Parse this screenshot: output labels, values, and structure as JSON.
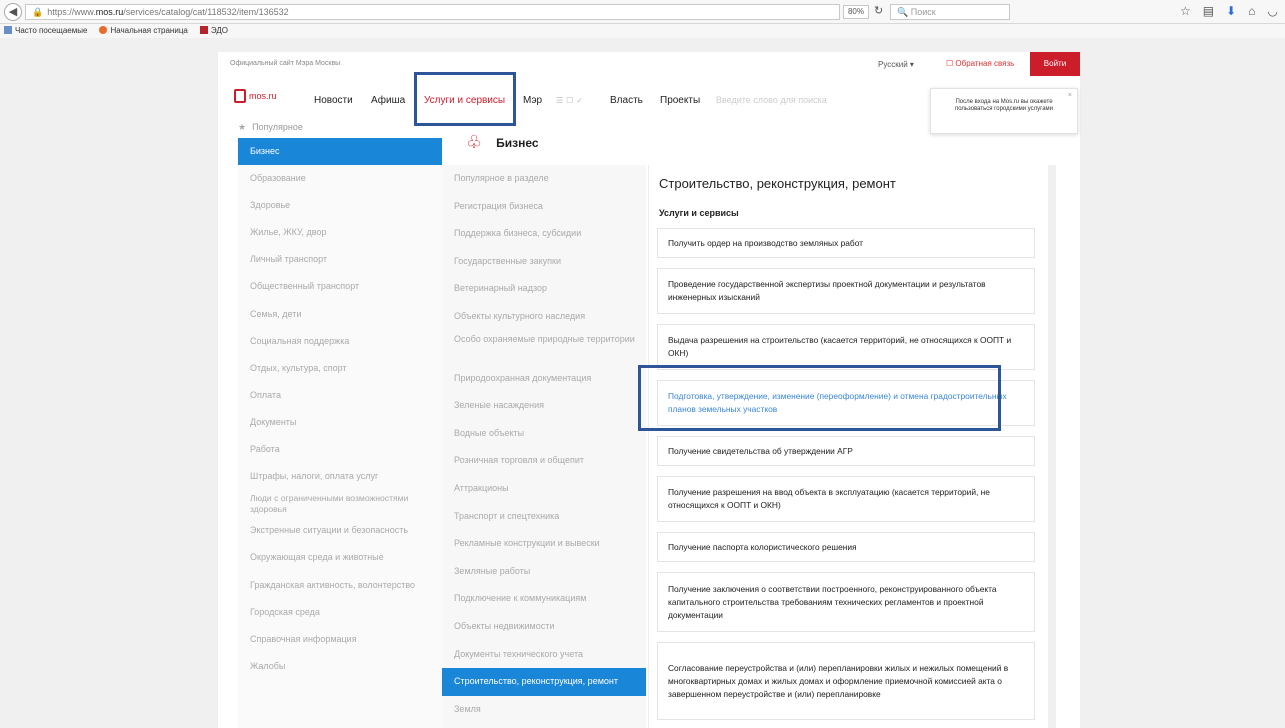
{
  "browser": {
    "url_prefix": "https://www.",
    "url_domain": "mos.ru",
    "url_path": "/services/catalog/cat/118532/item/136532",
    "zoom": "80%",
    "search_placeholder": "Поиск",
    "bookmarks": [
      "Часто посещаемые",
      "Начальная страница",
      "ЭДО"
    ]
  },
  "header": {
    "official": "Официальный сайт Мэра Москвы",
    "language": "Русский",
    "feedback": "Обратная связь",
    "login": "Войти"
  },
  "nav": {
    "logo": "mos.ru",
    "items": [
      "Новости",
      "Афиша",
      "Услуги и сервисы",
      "Мэр",
      "Власть",
      "Проекты"
    ],
    "search_placeholder": "Введите слово для поиска"
  },
  "popup": {
    "text": "После входа на Mos.ru вы окажете пользоваться городскими услугами",
    "close": "×"
  },
  "left": {
    "popular": "Популярное",
    "categories": [
      "Бизнес",
      "Образование",
      "Здоровье",
      "Жилье, ЖКУ, двор",
      "Личный транспорт",
      "Общественный транспорт",
      "Семья, дети",
      "Социальная поддержка",
      "Отдых, культура, спорт",
      "Оплата",
      "Документы",
      "Работа",
      "Штрафы, налоги, оплата услуг",
      "Люди с ограниченными возможностями здоровья",
      "Экстренные ситуации и безопасность",
      "Окружающая среда и животные",
      "Гражданская активность, волонтерство",
      "Городская среда",
      "Справочная информация",
      "Жалобы"
    ]
  },
  "middle": {
    "title": "Бизнес",
    "items": [
      "Популярное в разделе",
      "Регистрация бизнеса",
      "Поддержка бизнеса, субсидии",
      "Государственные закупки",
      "Ветеринарный надзор",
      "Объекты культурного наследия",
      "Особо охраняемые природные территории",
      "Природоохранная документация",
      "Зеленые насаждения",
      "Водные объекты",
      "Розничная торговля и общепит",
      "Аттракционы",
      "Транспорт и спецтехника",
      "Рекламные конструкции и вывески",
      "Земляные работы",
      "Подключение к коммуникациям",
      "Объекты недвижимости",
      "Документы технического учета",
      "Строительство, реконструкция, ремонт",
      "Земля"
    ]
  },
  "right": {
    "title": "Строительство, реконструкция, ремонт",
    "subtitle": "Услуги и сервисы",
    "services": [
      "Получить ордер на производство земляных работ",
      "Проведение государственной экспертизы проектной документации и результатов инженерных изысканий",
      "Выдача разрешения на строительство (касается территорий, не относящихся к ООПТ и ОКН)",
      "Подготовка, утверждение, изменение (переоформление) и отмена градостроительных планов земельных участков",
      "Получение свидетельства об утверждении АГР",
      "Получение разрешения на ввод объекта в эксплуатацию (касается территорий, не относящихся к ООПТ и ОКН)",
      "Получение паспорта колористического решения",
      "Получение заключения о соответствии построенного, реконструированного объекта капитального строительства требованиям технических регламентов и проектной документации",
      "Согласование переустройства и (или) перепланировки жилых и нежилых помещений в многоквартирных домах и жилых домах и оформление приемочной комиссией акта о завершенном переустройстве и (или) перепланировке"
    ]
  }
}
